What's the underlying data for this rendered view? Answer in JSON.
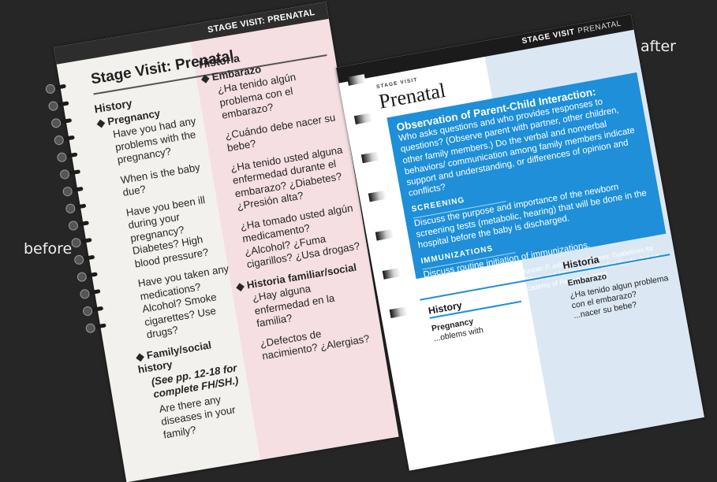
{
  "captions": {
    "before": "before",
    "after": "after"
  },
  "before_page": {
    "header": "STAGE VISIT: PRENATAL",
    "title": "Stage Visit: Prenatal",
    "left": {
      "section": "History",
      "bullet1": "◆ Pregnancy",
      "q1": "Have you had any problems with the pregnancy?",
      "q2": "When is the baby due?",
      "q3": "Have you been ill during your pregnancy? Diabetes? High blood pressure?",
      "q4": "Have you taken any medications? Alcohol? Smoke cigarettes? Use drugs?",
      "bullet2": "◆ Family/social history",
      "see": "(See pp. 12-18 for complete FH/SH.)",
      "q5": "Are there any diseases in your family?"
    },
    "right": {
      "section": "Historia",
      "bullet1": "◆ Embarazo",
      "q1": "¿Ha tenido algún problema con el embarazo?",
      "q2": "¿Cuándo debe nacer su bebe?",
      "q3": "¿Ha tenido usted alguna enfermedad durante el embarazo? ¿Diabetes? ¿Presión alta?",
      "q4": "¿Ha tomado usted algún medicamento? ¿Alcohol? ¿Fuma cigarillos? ¿Usa drogas?",
      "bullet2": "◆ Historia familiar/social",
      "q5": "¿Hay alguna enfermedad en la familia?",
      "q6": "¿Defectos de nacimiento? ¿Alergias?"
    }
  },
  "after_page": {
    "header_main": "STAGE VISIT",
    "header_sub": "PRENATAL",
    "stage_label": "STAGE VISIT",
    "title": "Prenatal",
    "box": {
      "obs_title": "Observation of Parent-Child Interaction:",
      "obs_text": "Who asks questions and who provides responses to questions? (Observe parent with partner, other children, other family members.) Do the verbal and nonverbal behaviors/ communication among family members indicate support and understanding, or differences of opinion and conflicts?",
      "screening_head": "SCREENING",
      "screening_text": "Discuss the purpose and importance of the newborn screening tests (metabolic, hearing) that will be done in the hospital before the baby is discharged.",
      "immun_head": "IMMUNIZATIONS",
      "immun_text": "Discuss routine initiation of immunizations.",
      "source": "SOURCE: Hagan JF, Shaw JS, Duncan P, eds. Bright Futures: Guidelines for Health Supervision of Infants, Children, and Adolescents Pocket Guide. 3rd ed. Elk Grove Village, IL: American Academy of Pediatrics; 2008"
    },
    "history": "History",
    "historia": "Historia",
    "en_bullet": "Pregnancy",
    "en_q": "...oblems with",
    "es_bullet": "Embarazo",
    "es_q1": "¿Ha tenido algun problema con el embarazo?",
    "es_q2": "...nacer su bebe?"
  }
}
